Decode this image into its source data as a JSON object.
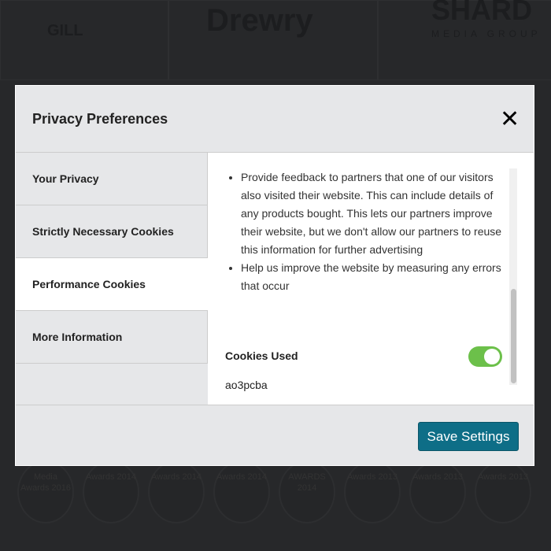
{
  "background": {
    "logos": [
      "GILL",
      "Drewry",
      "SHARD",
      "MEDIA GROUP"
    ],
    "badges": [
      "Media Awards 2016",
      "Awards 2014",
      "Awards 2014",
      "Awards 2014",
      "AWARDS 2014",
      "Awards 2013",
      "Awards 2013",
      "Awards 2013"
    ]
  },
  "modal": {
    "title": "Privacy Preferences",
    "close_icon": "close-x-icon",
    "sidebar": {
      "items": [
        {
          "label": "Your Privacy"
        },
        {
          "label": "Strictly Necessary Cookies"
        },
        {
          "label": "Performance Cookies",
          "active": true
        },
        {
          "label": "More Information"
        }
      ]
    },
    "content": {
      "bullets": [
        "Provide feedback to partners that one of our visitors also visited their website. This can include details of any products bought. This lets our partners improve their website, but we don't allow our partners to reuse this information for further advertising",
        "Help us improve the website by measuring any errors that occur"
      ],
      "cookies_used_label": "Cookies Used",
      "toggle_on": true,
      "toggle_color": "#6cc04a",
      "cookie_name": "ao3pcba"
    },
    "footer": {
      "save_label": "Save Settings",
      "save_color": "#0e6e87"
    }
  }
}
